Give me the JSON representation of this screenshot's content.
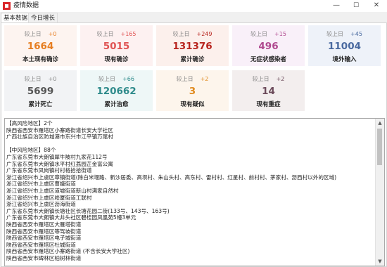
{
  "window": {
    "title": "疫情数据",
    "minimize": "—",
    "maximize": "☐",
    "close": "✕"
  },
  "tabs": [
    "基本数据",
    "今日增长"
  ],
  "cards": [
    {
      "name": "local-confirmed",
      "compare": "较上日",
      "delta": "+0",
      "value": "1664",
      "label": "本土现有确诊",
      "bg": "#fdf4f0",
      "value_color": "#e67e22",
      "delta_color": "#e67e22"
    },
    {
      "name": "current-confirmed",
      "compare": "较上日",
      "delta": "+165",
      "value": "5015",
      "label": "现有确诊",
      "bg": "#fdf1f1",
      "value_color": "#e05252",
      "delta_color": "#e05252"
    },
    {
      "name": "total-confirmed",
      "compare": "较上日",
      "delta": "+249",
      "value": "131376",
      "label": "累计确诊",
      "bg": "#fcf0ec",
      "value_color": "#b8251f",
      "delta_color": "#b8251f"
    },
    {
      "name": "asymptomatic",
      "compare": "较上日",
      "delta": "+15",
      "value": "496",
      "label": "无症状感染者",
      "bg": "#f9f0f9",
      "value_color": "#b0498f",
      "delta_color": "#b0498f"
    },
    {
      "name": "imported",
      "compare": "较上日",
      "delta": "+45",
      "value": "11004",
      "label": "境外输入",
      "bg": "#eef2f9",
      "value_color": "#4a6aa0",
      "delta_color": "#4a6aa0"
    },
    {
      "name": "total-deaths",
      "compare": "较上日",
      "delta": "+0",
      "value": "5699",
      "label": "累计死亡",
      "bg": "#f2f3f5",
      "value_color": "#555555",
      "delta_color": "#888888"
    },
    {
      "name": "total-cured",
      "compare": "较上日",
      "delta": "+66",
      "value": "120662",
      "label": "累计治愈",
      "bg": "#eef7f7",
      "value_color": "#2e8b8b",
      "delta_color": "#2e8b8b"
    },
    {
      "name": "suspected",
      "compare": "较上日",
      "delta": "+2",
      "value": "3",
      "label": "现有疑似",
      "bg": "#fdf5ec",
      "value_color": "#e08a1e",
      "delta_color": "#e08a1e"
    },
    {
      "name": "severe",
      "compare": "较上日",
      "delta": "+2",
      "value": "14",
      "label": "现有重症",
      "bg": "#f3eeee",
      "value_color": "#6b4a5a",
      "delta_color": "#6b4a5a"
    }
  ],
  "list_lines": [
    "【高风险地区】2个",
    "陕西省西安市雁塔区小寨路街道长安大学社区",
    "广西壮族自治区防城港市东兴市江平镇万尾村",
    "",
    "【中风险地区】88个",
    "广东省东莞市大朗镇犀牛陂村九家花112号",
    "广东省东莞市大朗镇水平村红荔园芷金富公寓",
    "广东省东莞市凤岗镇村村格拾拾街道",
    "浙江省绍兴市上虞区章镇街道(除白米堰路、新沙居委、高坝村、朱山头村、高东村、雷村村、红星村、前村村、茅家村、沥西村以外的区域)",
    "浙江省绍兴市上虞区曹娥街道",
    "浙江省绍兴市上虞区道墟街道新山村满家自然村",
    "浙江省绍兴市上虞区崧厦街道工联村",
    "浙江省绍兴市上虞区沥海街道",
    "广东省东莞市大朗镇长塘社区长塘花园二街(133号、143号、163号)",
    "广东省东莞市大朗镇大井头社区碧桂园凤凰苑5幢3单元",
    "陕西省西安市雁塔区大雁塔街道",
    "陕西省西安市雁塔区等驾坡街道",
    "陕西省西安市雁塔区电子城街道",
    "陕西省西安市雁塔区杜城街道",
    "陕西省西安市雁塔区小寨路街道  (不含长安大学社区)",
    "陕西省西安市碑林区柏树林街道"
  ]
}
